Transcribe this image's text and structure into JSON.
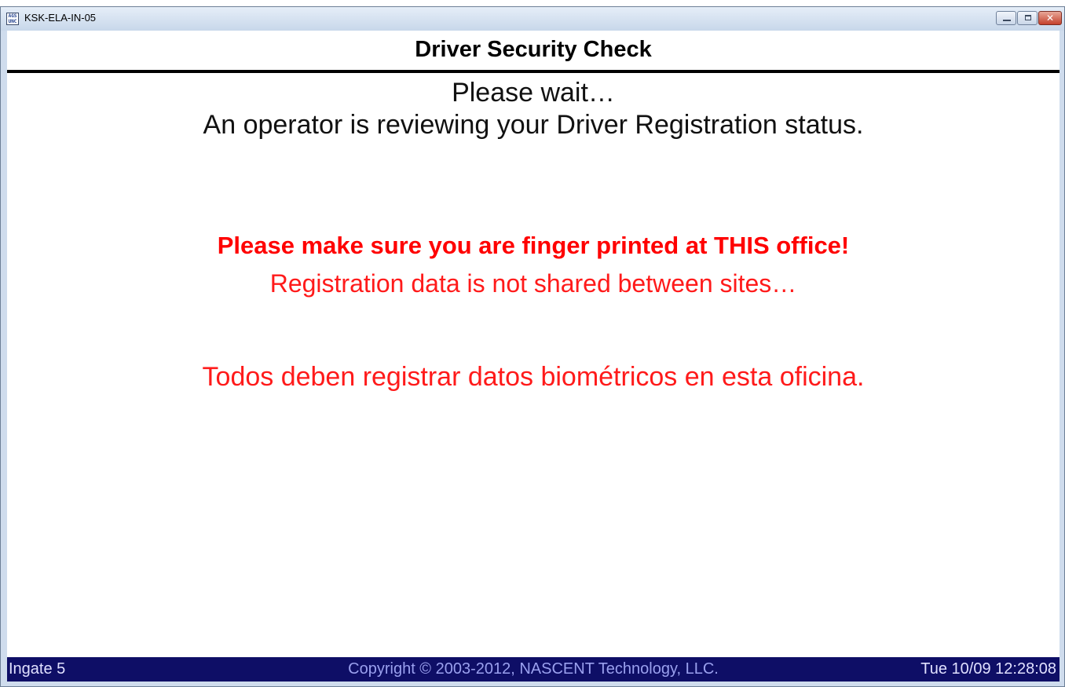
{
  "window": {
    "title": "KSK-ELA-IN-05",
    "icon": "ags-unc-app-icon",
    "controls": [
      "minimize",
      "maximize",
      "close"
    ]
  },
  "header": {
    "title": "Driver Security Check"
  },
  "messages": {
    "wait": "Please wait…",
    "reviewing": "An operator is reviewing your Driver Registration status.",
    "warning": "Please make sure you are finger printed at THIS office!",
    "not_shared": "Registration data is not shared between sites…",
    "spanish": "Todos deben registrar datos biométricos en esta oficina."
  },
  "status_bar": {
    "location": "Ingate 5",
    "copyright": "Copyright © 2003-2012, NASCENT Technology, LLC.",
    "datetime": "Tue  10/09  12:28:08"
  },
  "colors": {
    "title_bar": "#c8d7ea",
    "warning_text": "#ff0000",
    "status_bar_bg": "#0e0e66"
  }
}
